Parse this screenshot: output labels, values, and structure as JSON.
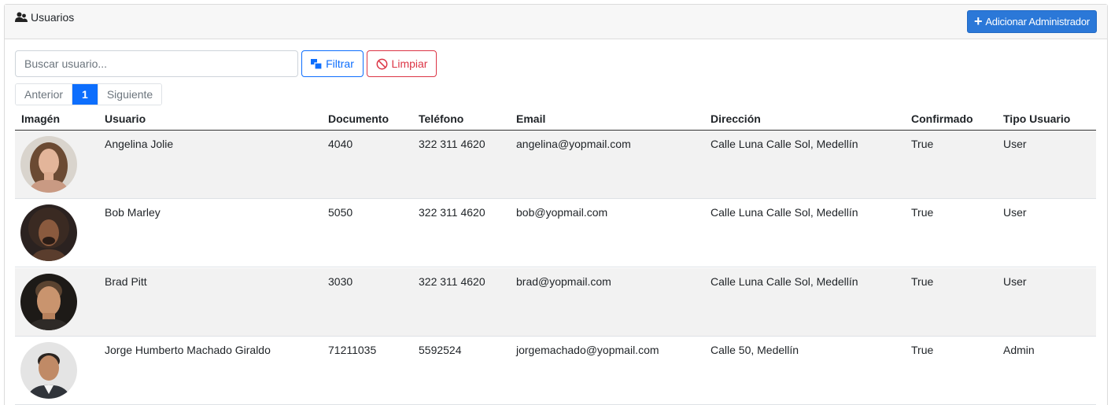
{
  "header": {
    "title": "Usuarios",
    "title_icon": "users-icon",
    "add_admin_label": "Adicionar Administrador",
    "add_admin_icon": "plus-icon",
    "brand_color": "#2b78d8"
  },
  "filters": {
    "search_placeholder": "Buscar usuario...",
    "search_value": "",
    "filter_label": "Filtrar",
    "filter_icon": "filter-icon",
    "clear_label": "Limpiar",
    "clear_icon": "ban-icon"
  },
  "pagination": {
    "previous_label": "Anterior",
    "current_page": "1",
    "next_label": "Siguiente"
  },
  "table": {
    "columns": [
      "Imagén",
      "Usuario",
      "Documento",
      "Teléfono",
      "Email",
      "Dirección",
      "Confirmado",
      "Tipo Usuario"
    ],
    "rows": [
      {
        "avatar": "avatar-photo",
        "user": "Angelina Jolie",
        "document": "4040",
        "phone": "322 311 4620",
        "email": "angelina@yopmail.com",
        "address": "Calle Luna Calle Sol, Medellín",
        "confirmed": "True",
        "type": "User"
      },
      {
        "avatar": "avatar-photo",
        "user": "Bob Marley",
        "document": "5050",
        "phone": "322 311 4620",
        "email": "bob@yopmail.com",
        "address": "Calle Luna Calle Sol, Medellín",
        "confirmed": "True",
        "type": "User"
      },
      {
        "avatar": "avatar-photo",
        "user": "Brad Pitt",
        "document": "3030",
        "phone": "322 311 4620",
        "email": "brad@yopmail.com",
        "address": "Calle Luna Calle Sol, Medellín",
        "confirmed": "True",
        "type": "User"
      },
      {
        "avatar": "avatar-photo",
        "user": "Jorge Humberto Machado Giraldo",
        "document": "71211035",
        "phone": "5592524",
        "email": "jorgemachado@yopmail.com",
        "address": "Calle 50, Medellín",
        "confirmed": "True",
        "type": "Admin"
      }
    ]
  }
}
